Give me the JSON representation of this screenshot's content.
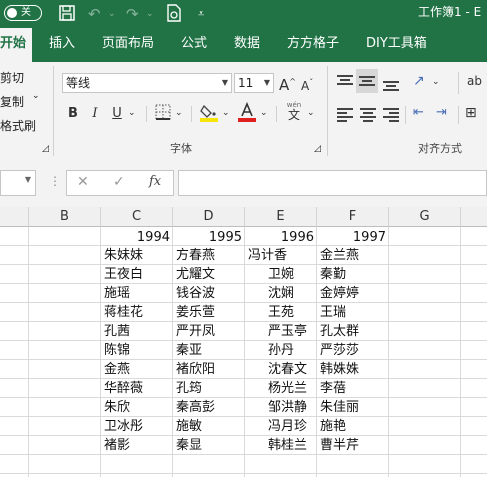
{
  "titlebar": {
    "autosave_label": "关",
    "window_title": "工作簿1 - E"
  },
  "tabs": [
    "开始",
    "插入",
    "页面布局",
    "公式",
    "数据",
    "方方格子",
    "DIY工具箱"
  ],
  "ribbon": {
    "clipboard": {
      "cut": "剪切",
      "copy": "复制",
      "format_painter": "格式刷"
    },
    "font": {
      "font_name": "等线",
      "font_size": "11",
      "grow_label": "A",
      "shrink_label": "A",
      "bold": "B",
      "italic": "I",
      "underline": "U",
      "wen_label": "wén",
      "wen_char": "文",
      "group_label": "字体",
      "fill_color": "#f5e50a",
      "font_color": "#e02020"
    },
    "alignment": {
      "group_label": "对齐方式"
    }
  },
  "formula_bar": {
    "cancel": "✕",
    "enter": "✓",
    "fx": "fx",
    "value": ""
  },
  "columns": [
    "B",
    "C",
    "D",
    "E",
    "F",
    "G"
  ],
  "sheet": {
    "header_years": [
      "1994",
      "1995",
      "1996",
      "1997"
    ],
    "rows": [
      [
        "朱妹妹",
        "方春燕",
        "冯计香",
        "金兰燕"
      ],
      [
        "王夜白",
        "尤耀文",
        "卫婉",
        "秦勤"
      ],
      [
        "施瑶",
        "钱谷波",
        "沈娴",
        "金婷婷"
      ],
      [
        "蒋桂花",
        "姜乐萱",
        "王苑",
        "王瑞"
      ],
      [
        "孔茜",
        "严开凤",
        "严玉亭",
        "孔太群"
      ],
      [
        "陈锦",
        "秦亚",
        "孙丹",
        "严莎莎"
      ],
      [
        "金燕",
        "褚欣阳",
        "沈春文",
        "韩姝姝"
      ],
      [
        "华醉薇",
        "孔筠",
        "杨光兰",
        "李蓓"
      ],
      [
        "朱欣",
        "秦高彭",
        "邹洪静",
        "朱佳丽"
      ],
      [
        "卫冰彤",
        "施敏",
        "冯月珍",
        "施艳"
      ],
      [
        "褚影",
        "秦显",
        "韩桂兰",
        "曹半芹"
      ]
    ]
  }
}
